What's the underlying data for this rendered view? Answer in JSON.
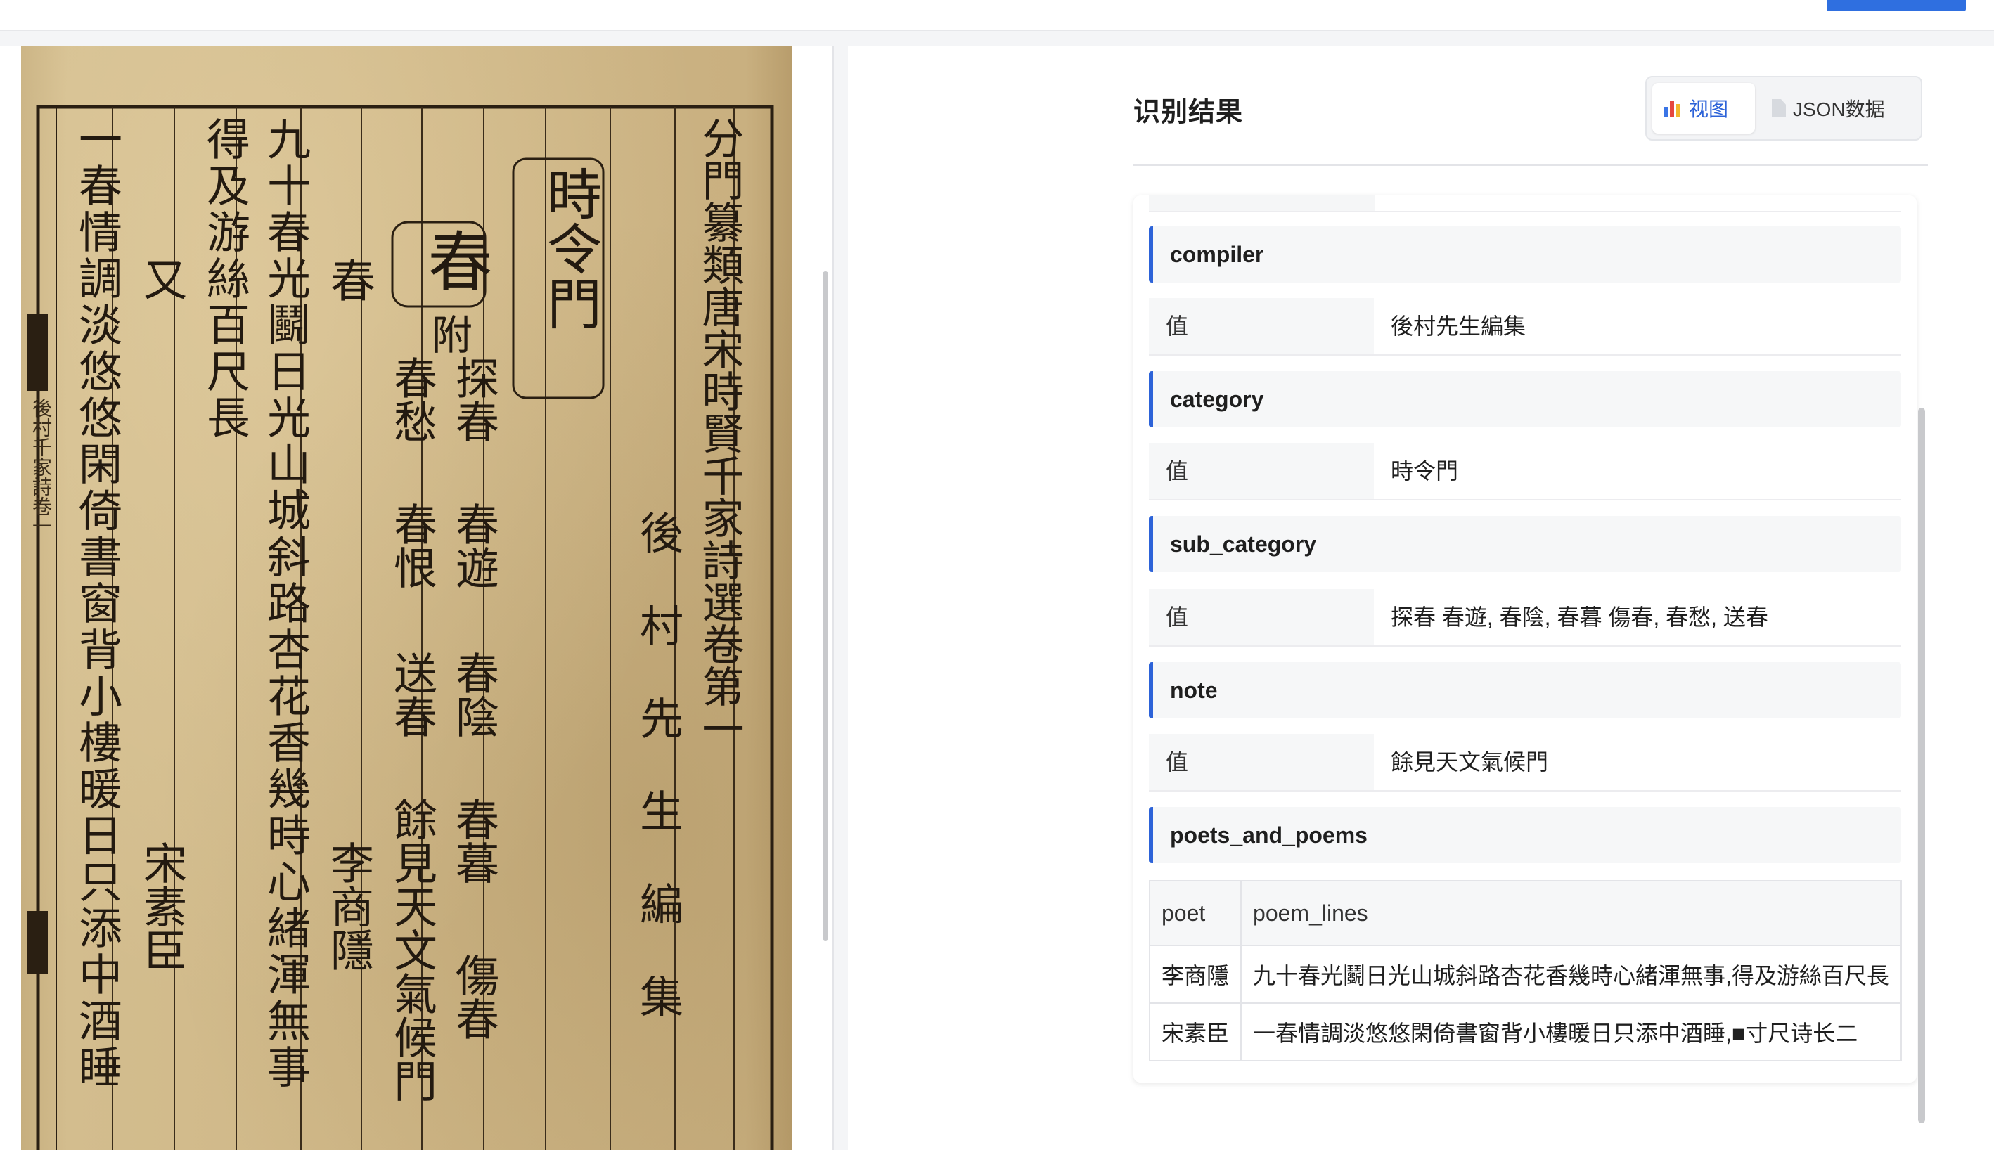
{
  "header": {
    "title": "识别结果"
  },
  "view_toggle": {
    "view": {
      "label": "视图",
      "icon": "bar-chart-icon",
      "active": true
    },
    "json": {
      "label": "JSON数据",
      "icon": "document-icon",
      "active": false
    }
  },
  "accent_color": "#2d63d8",
  "fields": [
    {
      "key": "compiler",
      "value_label": "值",
      "value": "後村先生編集"
    },
    {
      "key": "category",
      "value_label": "值",
      "value": "時令門"
    },
    {
      "key": "sub_category",
      "value_label": "值",
      "value": "探春 春遊, 春陰, 春暮 傷春, 春愁, 送春"
    },
    {
      "key": "note",
      "value_label": "值",
      "value": "餘見天文氣候門"
    }
  ],
  "poets_and_poems": {
    "label": "poets_and_poems",
    "columns": [
      "poet",
      "poem_lines"
    ],
    "rows": [
      {
        "poet": "李商隱",
        "poem_lines": "九十春光鬬日光山城斜路杏花香幾時心緒渾無事,得及游絲百尺長"
      },
      {
        "poet": "宋素臣",
        "poem_lines": "一春情調淡悠悠閑倚書窗背小樓暖日只添中酒睡,■寸尺诗长二"
      }
    ]
  },
  "scan": {
    "columns": [
      "分門纂類唐宋時賢千家詩選卷第一",
      "後村先生編集",
      "時令門",
      "春",
      "附",
      "探春",
      "春遊",
      "春陰",
      "春暮",
      "傷春",
      "春愁",
      "春恨",
      "送春",
      "餘見天文氣候門",
      "春",
      "李商隱",
      "九十春光鬬日光山城斜路杏花香幾時心緒渾無事",
      "得及游絲百尺長",
      "又",
      "宋素臣",
      "一春情調淡悠悠閑倚書窗背小樓暖日只添中酒睡"
    ],
    "margin_text": "後村千家詩卷一"
  }
}
